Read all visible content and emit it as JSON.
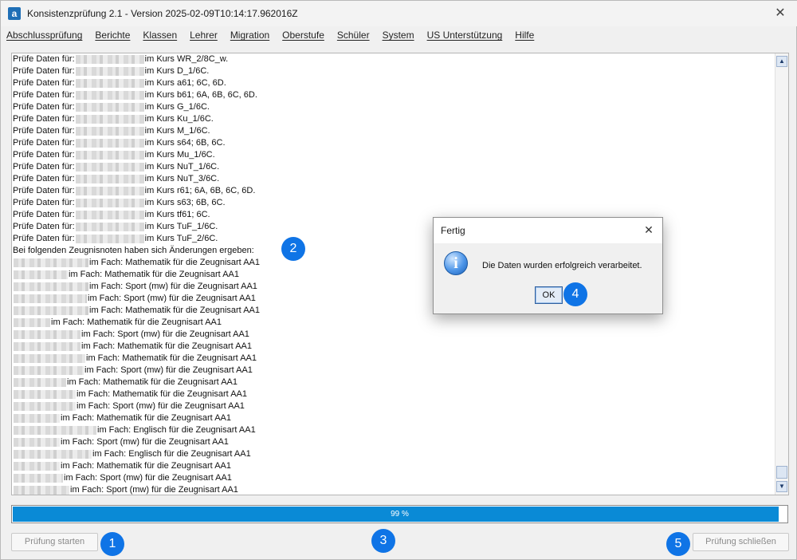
{
  "window": {
    "app_icon": "a",
    "title": "Konsistenzprüfung 2.1 - Version 2025-02-09T10:14:17.962016Z",
    "close_glyph": "✕"
  },
  "menu": [
    "Abschlussprüfung",
    "Berichte",
    "Klassen",
    "Lehrer",
    "Migration",
    "Oberstufe",
    "Schüler",
    "System",
    "US Unterstützung",
    "Hilfe"
  ],
  "log": {
    "lines": [
      {
        "prefix": "Prüfe Daten für:",
        "redacted": true,
        "text": "im Kurs WR_2/8C_w."
      },
      {
        "prefix": "Prüfe Daten für:",
        "redacted": true,
        "text": "im Kurs D_1/6C."
      },
      {
        "prefix": "Prüfe Daten für:",
        "redacted": true,
        "text": "im Kurs a61; 6C, 6D."
      },
      {
        "prefix": "Prüfe Daten für:",
        "redacted": true,
        "text": "im Kurs b61; 6A, 6B, 6C, 6D."
      },
      {
        "prefix": "Prüfe Daten für:",
        "redacted": true,
        "text": "im Kurs G_1/6C."
      },
      {
        "prefix": "Prüfe Daten für:",
        "redacted": true,
        "text": "im Kurs Ku_1/6C."
      },
      {
        "prefix": "Prüfe Daten für:",
        "redacted": true,
        "text": "im Kurs M_1/6C."
      },
      {
        "prefix": "Prüfe Daten für:",
        "redacted": true,
        "text": "im Kurs s64; 6B, 6C."
      },
      {
        "prefix": "Prüfe Daten für:",
        "redacted": true,
        "text": "im Kurs Mu_1/6C."
      },
      {
        "prefix": "Prüfe Daten für:",
        "redacted": true,
        "text": "im Kurs NuT_1/6C."
      },
      {
        "prefix": "Prüfe Daten für:",
        "redacted": true,
        "text": "im Kurs NuT_3/6C."
      },
      {
        "prefix": "Prüfe Daten für:",
        "redacted": true,
        "text": "im Kurs r61; 6A, 6B, 6C, 6D."
      },
      {
        "prefix": "Prüfe Daten für:",
        "redacted": true,
        "text": "im Kurs s63; 6B, 6C."
      },
      {
        "prefix": "Prüfe Daten für:",
        "redacted": true,
        "text": "im Kurs tf61; 6C."
      },
      {
        "prefix": "Prüfe Daten für:",
        "redacted": true,
        "text": "im Kurs TuF_1/6C."
      },
      {
        "prefix": "Prüfe Daten für:",
        "redacted": true,
        "text": "im Kurs TuF_2/6C."
      },
      {
        "prefix": "",
        "redacted": false,
        "text": "Bei folgenden Zeugnisnoten haben sich Änderungen ergeben:"
      },
      {
        "prefix": "",
        "redacted": true,
        "text": "im Fach: Mathematik für die Zeugnisart AA1"
      },
      {
        "prefix": "",
        "redacted": true,
        "text": "im Fach: Mathematik für die Zeugnisart AA1"
      },
      {
        "prefix": "",
        "redacted": true,
        "text": "im Fach: Sport (mw) für die Zeugnisart AA1"
      },
      {
        "prefix": "",
        "redacted": true,
        "text": "im Fach: Sport (mw) für die Zeugnisart AA1"
      },
      {
        "prefix": "",
        "redacted": true,
        "text": "im Fach: Mathematik für die Zeugnisart AA1"
      },
      {
        "prefix": "",
        "redacted": true,
        "text": "im Fach: Mathematik für die Zeugnisart AA1"
      },
      {
        "prefix": "",
        "redacted": true,
        "text": "im Fach: Sport (mw) für die Zeugnisart AA1"
      },
      {
        "prefix": "",
        "redacted": true,
        "text": "im Fach: Mathematik für die Zeugnisart AA1"
      },
      {
        "prefix": "",
        "redacted": true,
        "text": "im Fach: Mathematik für die Zeugnisart AA1"
      },
      {
        "prefix": "",
        "redacted": true,
        "text": "im Fach: Sport (mw) für die Zeugnisart AA1"
      },
      {
        "prefix": "",
        "redacted": true,
        "text": "im Fach: Mathematik für die Zeugnisart AA1"
      },
      {
        "prefix": "",
        "redacted": true,
        "text": "im Fach: Mathematik für die Zeugnisart AA1"
      },
      {
        "prefix": "",
        "redacted": true,
        "text": "im Fach: Sport (mw) für die Zeugnisart AA1"
      },
      {
        "prefix": "",
        "redacted": true,
        "text": "im Fach: Mathematik für die Zeugnisart AA1"
      },
      {
        "prefix": "",
        "redacted": true,
        "text": "im Fach: Englisch für die Zeugnisart AA1"
      },
      {
        "prefix": "",
        "redacted": true,
        "text": "im Fach: Sport (mw) für die Zeugnisart AA1"
      },
      {
        "prefix": "",
        "redacted": true,
        "text": "im Fach: Englisch für die Zeugnisart AA1"
      },
      {
        "prefix": "",
        "redacted": true,
        "text": "im Fach: Mathematik für die Zeugnisart AA1"
      },
      {
        "prefix": "",
        "redacted": true,
        "text": "im Fach: Sport (mw) für die Zeugnisart AA1"
      },
      {
        "prefix": "",
        "redacted": true,
        "text": "im Fach: Sport (mw) für die Zeugnisart AA1"
      }
    ],
    "scroll_up_glyph": "▲",
    "scroll_down_glyph": "▼"
  },
  "progress": {
    "percent": 99,
    "label": "99 %",
    "color": "#0a8ad6"
  },
  "buttons": {
    "start": "Prüfung starten",
    "close": "Prüfung schließen"
  },
  "markers": [
    "1",
    "2",
    "3",
    "4",
    "5"
  ],
  "dialog": {
    "title": "Fertig",
    "close_glyph": "✕",
    "icon": "info-icon",
    "icon_glyph": "i",
    "message": "Die Daten wurden erfolgreich verarbeitet.",
    "ok_label": "OK"
  }
}
